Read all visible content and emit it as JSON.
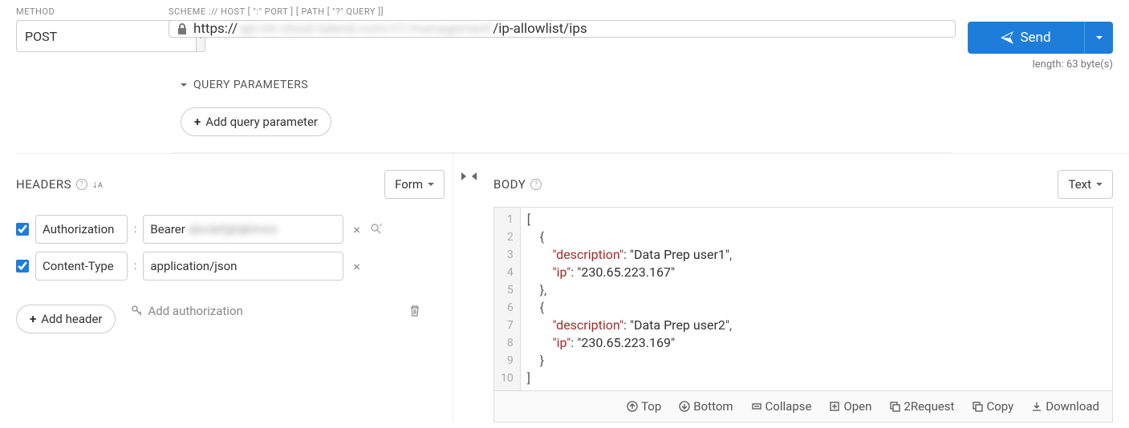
{
  "labels": {
    "method": "METHOD",
    "scheme": "SCHEME :// HOST [ \":\" PORT ] [ PATH [ \"?\" QUERY ]]",
    "query_params": "QUERY PARAMETERS",
    "headers": "HEADERS",
    "body": "BODY"
  },
  "method": {
    "value": "POST"
  },
  "url": {
    "prefix": "https://",
    "blurred": "api.int.cloud.talend.com/v1/management",
    "suffix": "/ip-allowlist/ips"
  },
  "send": {
    "label": "Send"
  },
  "length_info": "length: 63 byte(s)",
  "buttons": {
    "add_query": "Add query parameter",
    "add_header": "Add header",
    "add_auth": "Add authorization",
    "form": "Form",
    "text": "Text"
  },
  "headers": [
    {
      "checked": true,
      "name": "Authorization",
      "value_prefix": "Bearer",
      "value_blurred": "abcdefghijklmno",
      "show_search": true
    },
    {
      "checked": true,
      "name": "Content-Type",
      "value": "application/json",
      "show_search": false
    }
  ],
  "code": {
    "lines": [
      "[",
      "    {",
      "        \"description\": \"Data Prep user1\",",
      "        \"ip\": \"230.65.223.167\"",
      "    },",
      "    {",
      "        \"description\": \"Data Prep user2\",",
      "        \"ip\": \"230.65.223.169\"",
      "    }",
      "]"
    ]
  },
  "toolbar": {
    "top": "Top",
    "bottom": "Bottom",
    "collapse": "Collapse",
    "open": "Open",
    "torequest": "2Request",
    "copy": "Copy",
    "download": "Download"
  }
}
